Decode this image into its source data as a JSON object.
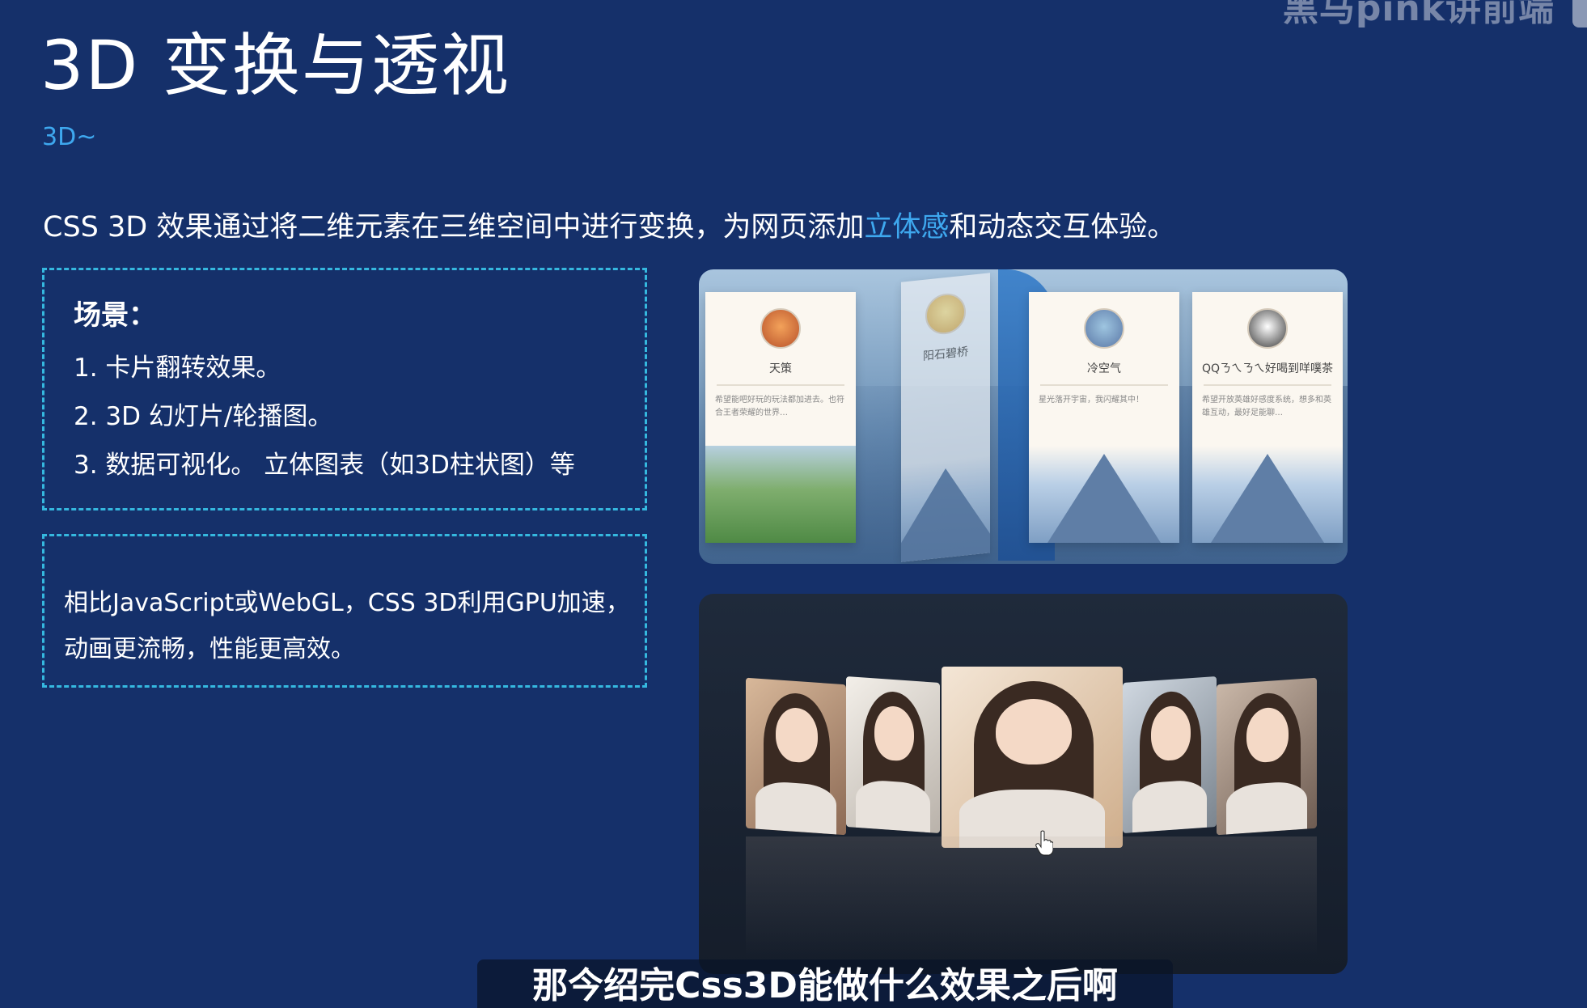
{
  "watermark": "黑马pink讲前端",
  "title": "3D 变换与透视",
  "subtitle": "3D~",
  "intro": {
    "before": "CSS 3D 效果通过将二维元素在三维空间中进行变换，为网页添加",
    "highlight": "立体感",
    "after": "和动态交互体验。"
  },
  "scenes": {
    "heading": "场景：",
    "items": [
      "1. 卡片翻转效果。",
      "2. 3D 幻灯片/轮播图。",
      "3. 数据可视化。 立体图表（如3D柱状图）等"
    ]
  },
  "performance": {
    "line1": "相比JavaScript或WebGL，CSS 3D利用GPU加速，",
    "line2": "动画更流畅，性能更高效。"
  },
  "cards": [
    {
      "name": "天策",
      "desc": "希望能吧好玩的玩法都加进去。也符合王者荣耀的世界…"
    },
    {
      "name": "阳石碧桥",
      "desc": ""
    },
    {
      "name": "冷空气",
      "desc": "星光落开宇宙，我闪耀其中！"
    },
    {
      "name": "QQㄋㄟㄋㄟ好喝到咩噗茶",
      "desc": "希望开放英雄好感度系统，想多和英雄互动，最好足能聊…"
    }
  ],
  "caption": "那今绍完Css3D能做什么效果之后啊"
}
